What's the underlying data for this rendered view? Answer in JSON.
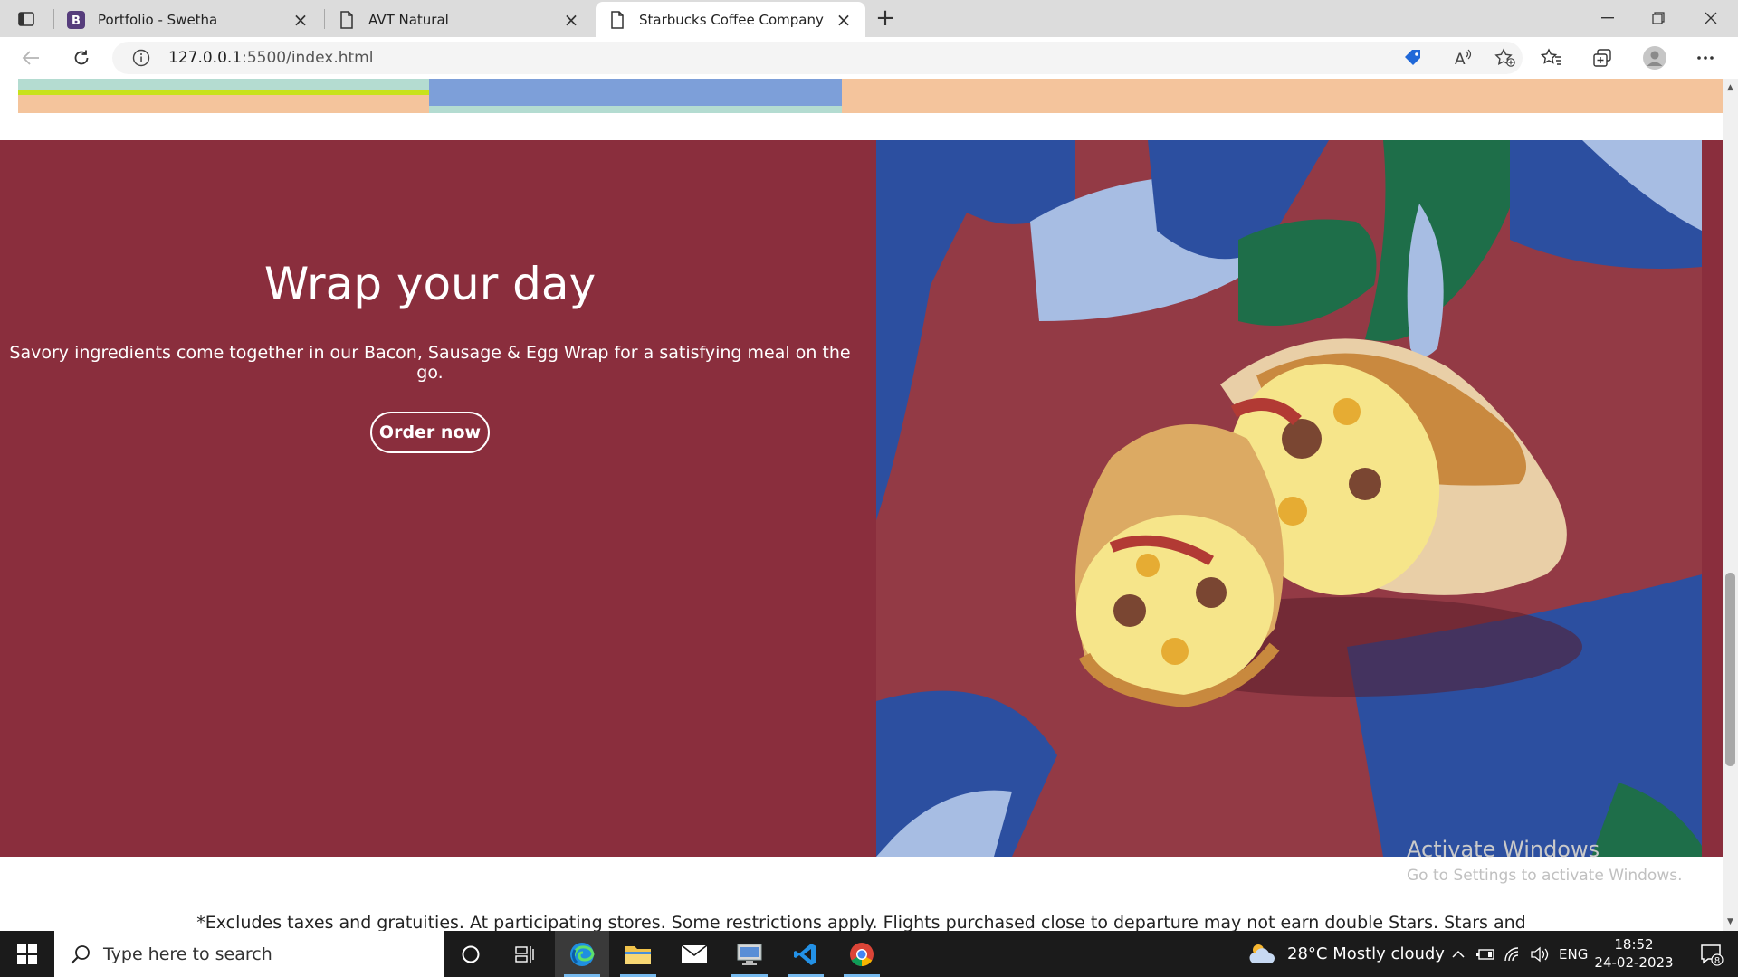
{
  "browser": {
    "tabs": [
      {
        "label": "Portfolio - Swetha",
        "favicon": "bootstrap-b-icon",
        "active": false
      },
      {
        "label": "AVT Natural",
        "favicon": "page-icon",
        "active": false
      },
      {
        "label": "Starbucks Coffee Company",
        "favicon": "page-icon",
        "active": true
      }
    ],
    "new_tab_label": "+",
    "address": {
      "host": "127.0.0.1",
      "path": ":5500/index.html"
    }
  },
  "page": {
    "hero": {
      "title": "Wrap your day",
      "description": "Savory ingredients come together in our Bacon, Sausage & Egg Wrap for a satisfying meal on the go.",
      "button_label": "Order now",
      "bg_color": "#8a2e3d"
    },
    "footnote": "*Excludes taxes and gratuities. At participating stores. Some restrictions apply. Flights purchased close to departure may not earn double Stars. Stars and"
  },
  "watermark": {
    "line1": "Activate Windows",
    "line2": "Go to Settings to activate Windows."
  },
  "taskbar": {
    "search_placeholder": "Type here to search",
    "weather": "28°C  Mostly cloudy",
    "language": "ENG",
    "time": "18:52",
    "date": "24-02-2023",
    "notification_count": "8"
  }
}
